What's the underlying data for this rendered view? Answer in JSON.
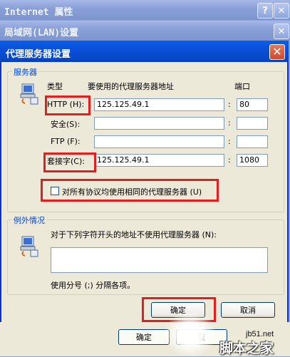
{
  "back_window_1": {
    "title": "Internet 属性",
    "help_btn": "?",
    "close_btn": "✕"
  },
  "back_window_2": {
    "title": "局域网(LAN)设置",
    "close_btn": "✕"
  },
  "back_buttons": {
    "ok": "确定",
    "cancel": "取"
  },
  "dialog": {
    "title": "代理服务器设置",
    "close_btn": "✕",
    "servers_group": {
      "label": "服务器",
      "col_type": "类型",
      "col_address": "要使用的代理服务器地址",
      "col_port": "端口",
      "rows": [
        {
          "type": "HTTP (H):",
          "address": "125.125.49.1",
          "port": "80"
        },
        {
          "type": "安全(S):",
          "address": "",
          "port": ""
        },
        {
          "type": "FTP (F):",
          "address": "",
          "port": ""
        },
        {
          "type": "套接字(C):",
          "address": "125.125.49.1",
          "port": "1080"
        }
      ],
      "colon": ":",
      "same_proxy_label": "对所有协议均使用相同的代理服务器 (U)",
      "same_proxy_checked": false
    },
    "exceptions_group": {
      "label": "例外情况",
      "desc": "对于下列字符开头的地址不使用代理服务器 (N):",
      "textarea_value": "",
      "hint": "使用分号 (;) 分隔各项。"
    },
    "ok": "确定",
    "cancel": "取消"
  },
  "watermark": {
    "site": "jb51.net",
    "text": "脚本之家"
  }
}
